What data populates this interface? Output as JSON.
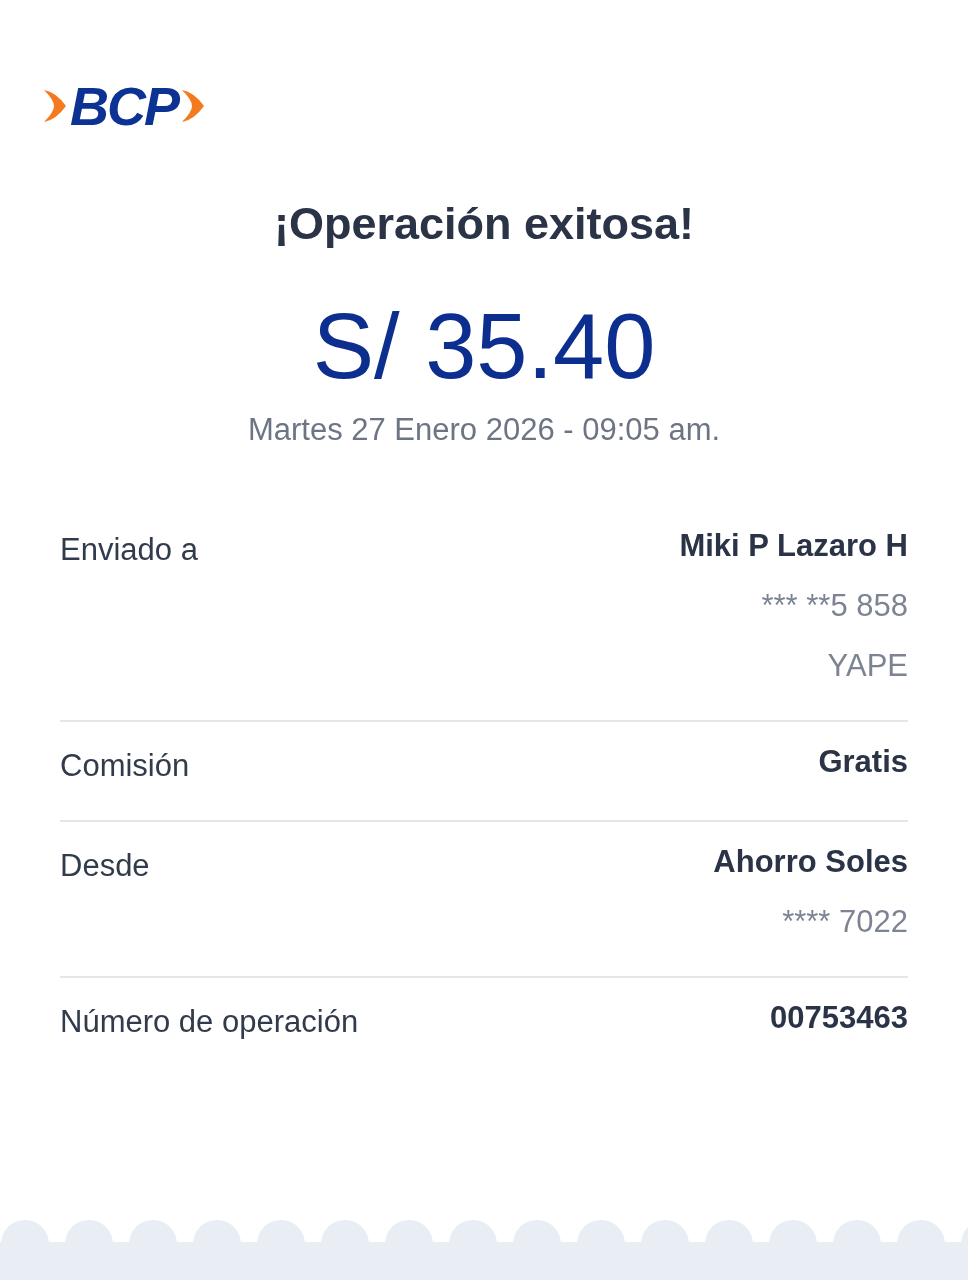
{
  "logo": {
    "text": "BCP"
  },
  "title": "¡Operación exitosa!",
  "amount": "S/ 35.40",
  "datetime": "Martes 27 Enero 2026 - 09:05 am.",
  "details": [
    {
      "label": "Enviado a",
      "value": "Miki P Lazaro H",
      "extra": [
        "*** **5 858",
        "YAPE"
      ]
    },
    {
      "label": "Comisión",
      "value": "Gratis"
    },
    {
      "label": "Desde",
      "value": "Ahorro Soles",
      "extra": [
        "**** 7022"
      ]
    },
    {
      "label": "Número de operación",
      "value": "00753463"
    }
  ]
}
